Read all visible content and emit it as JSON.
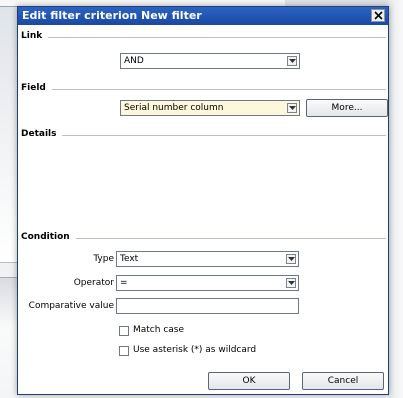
{
  "dialog": {
    "title": "Edit filter criterion New filter",
    "close_glyph": "close-icon"
  },
  "sections": {
    "link": "Link",
    "field": "Field",
    "details": "Details",
    "condition": "Condition"
  },
  "link": {
    "value": "AND"
  },
  "field": {
    "value": "Serial number column",
    "more_label": "More..."
  },
  "condition": {
    "type_label": "Type",
    "type_value": "Text",
    "operator_label": "Operator",
    "operator_value": "=",
    "comparative_label": "Comparative value",
    "comparative_value": "",
    "match_case_label": "Match case",
    "match_case_checked": false,
    "wildcard_label": "Use asterisk (*) as wildcard",
    "wildcard_checked": false
  },
  "buttons": {
    "ok": "OK",
    "cancel": "Cancel"
  },
  "colors": {
    "titlebar": "#1f4fb0",
    "focused_field_bg": "#fdf8dc",
    "border": "#6d7884"
  }
}
